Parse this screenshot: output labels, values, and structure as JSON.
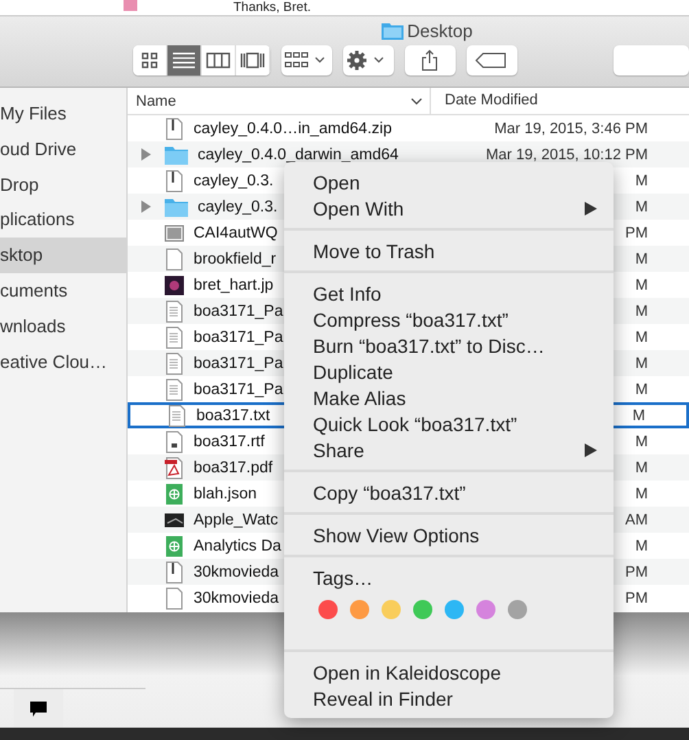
{
  "background_window": {
    "text": "Thanks, Bret."
  },
  "window": {
    "title": "Desktop"
  },
  "toolbar": {
    "view_modes": [
      {
        "kind": "icons",
        "selected": false
      },
      {
        "kind": "list",
        "selected": true
      },
      {
        "kind": "columns",
        "selected": false
      },
      {
        "kind": "coverflow",
        "selected": false
      }
    ]
  },
  "sidebar": {
    "items": [
      {
        "label": "My Files",
        "selected": false
      },
      {
        "label": "oud Drive",
        "selected": false
      },
      {
        "label": "Drop",
        "selected": false
      },
      {
        "label": "plications",
        "selected": false
      },
      {
        "label": "sktop",
        "selected": true
      },
      {
        "label": "cuments",
        "selected": false
      },
      {
        "label": "wnloads",
        "selected": false
      },
      {
        "label": "eative Clou…",
        "selected": false
      }
    ]
  },
  "table": {
    "columns": [
      "Name",
      "Date Modified"
    ],
    "rows": [
      {
        "kind": "zip",
        "name": "cayley_0.4.0…in_amd64.zip",
        "date": "Mar 19, 2015, 3:46 PM",
        "expandable": false,
        "selected": false
      },
      {
        "kind": "folder",
        "name": "cayley_0.4.0_darwin_amd64",
        "date": "Mar 19, 2015, 10:12 PM",
        "expandable": true,
        "selected": false
      },
      {
        "kind": "zip",
        "name": "cayley_0.3.",
        "date": "M",
        "expandable": false,
        "selected": false
      },
      {
        "kind": "folder",
        "name": "cayley_0.3.",
        "date": "M",
        "expandable": true,
        "selected": false
      },
      {
        "kind": "image",
        "name": "CAI4autWQ",
        "date": "PM",
        "expandable": false,
        "selected": false
      },
      {
        "kind": "blank",
        "name": "brookfield_r",
        "date": "M",
        "expandable": false,
        "selected": false
      },
      {
        "kind": "photo",
        "name": "bret_hart.jp",
        "date": "M",
        "expandable": false,
        "selected": false
      },
      {
        "kind": "doc",
        "name": "boa3171_Pa",
        "date": "M",
        "expandable": false,
        "selected": false
      },
      {
        "kind": "doc",
        "name": "boa3171_Pa",
        "date": "M",
        "expandable": false,
        "selected": false
      },
      {
        "kind": "doc",
        "name": "boa3171_Pa",
        "date": "M",
        "expandable": false,
        "selected": false
      },
      {
        "kind": "doc",
        "name": "boa3171_Pa",
        "date": "M",
        "expandable": false,
        "selected": false
      },
      {
        "kind": "text",
        "name": "boa317.txt",
        "date": "M",
        "expandable": false,
        "selected": true
      },
      {
        "kind": "rtf",
        "name": "boa317.rtf",
        "date": "M",
        "expandable": false,
        "selected": false
      },
      {
        "kind": "pdf",
        "name": "boa317.pdf",
        "date": "M",
        "expandable": false,
        "selected": false
      },
      {
        "kind": "json",
        "name": "blah.json",
        "date": "M",
        "expandable": false,
        "selected": false
      },
      {
        "kind": "video",
        "name": "Apple_Watc",
        "date": "AM",
        "expandable": false,
        "selected": false
      },
      {
        "kind": "json",
        "name": "Analytics Da",
        "date": "M",
        "expandable": false,
        "selected": false
      },
      {
        "kind": "zip",
        "name": "30kmovieda",
        "date": "PM",
        "expandable": false,
        "selected": false
      },
      {
        "kind": "blank",
        "name": "30kmovieda",
        "date": "PM",
        "expandable": false,
        "selected": false
      }
    ]
  },
  "context_menu": {
    "sections": [
      {
        "items": [
          {
            "label": "Open",
            "submenu": false
          },
          {
            "label": "Open With",
            "submenu": true
          }
        ]
      },
      {
        "items": [
          {
            "label": "Move to Trash",
            "submenu": false
          }
        ]
      },
      {
        "items": [
          {
            "label": "Get Info",
            "submenu": false
          },
          {
            "label": "Compress “boa317.txt”",
            "submenu": false
          },
          {
            "label": "Burn “boa317.txt” to Disc…",
            "submenu": false
          },
          {
            "label": "Duplicate",
            "submenu": false
          },
          {
            "label": "Make Alias",
            "submenu": false
          },
          {
            "label": "Quick Look “boa317.txt”",
            "submenu": false
          },
          {
            "label": "Share",
            "submenu": true
          }
        ]
      },
      {
        "items": [
          {
            "label": "Copy “boa317.txt”",
            "submenu": false
          }
        ]
      },
      {
        "items": [
          {
            "label": "Show View Options",
            "submenu": false
          }
        ]
      },
      {
        "items": [
          {
            "label": "Tags…",
            "submenu": false
          }
        ],
        "tag_colors": [
          {
            "color": "#fc4c4c"
          },
          {
            "color": "#fd9a44"
          },
          {
            "color": "#f9cd5b"
          },
          {
            "color": "#3fc957"
          },
          {
            "color": "#2db7f4"
          },
          {
            "color": "#d583dd"
          },
          {
            "color": "#a3a3a3"
          }
        ]
      },
      {
        "items": [
          {
            "label": "Open in Kaleidoscope",
            "submenu": false
          },
          {
            "label": "Reveal in Finder",
            "submenu": false
          }
        ]
      }
    ]
  }
}
